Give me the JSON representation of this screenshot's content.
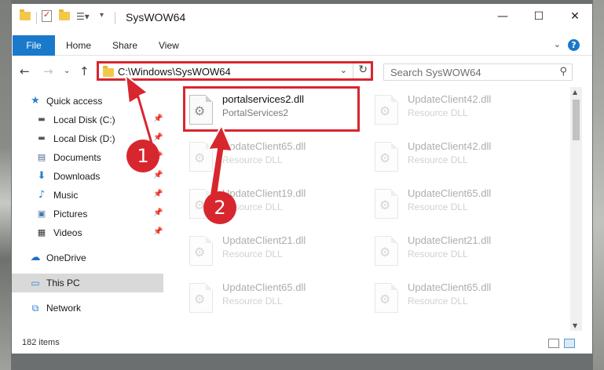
{
  "window": {
    "title": "SysWOW64",
    "controls": {
      "minimize": "—",
      "maximize": "☐",
      "close": "✕"
    }
  },
  "ribbon": {
    "tabs": [
      "File",
      "Home",
      "Share",
      "View"
    ],
    "help": "?"
  },
  "navbar": {
    "address": "C:\\Windows\\SysWOW64",
    "search_placeholder": "Search SysWOW64"
  },
  "sidebar": {
    "items": [
      {
        "label": "Quick access",
        "icon": "star-icon",
        "pinned": false
      },
      {
        "label": "Local Disk (C:)",
        "icon": "drive-icon",
        "pinned": true
      },
      {
        "label": "Local Disk (D:)",
        "icon": "drive-icon",
        "pinned": true
      },
      {
        "label": "Documents",
        "icon": "documents-icon",
        "pinned": true
      },
      {
        "label": "Downloads",
        "icon": "download-icon",
        "pinned": true
      },
      {
        "label": "Music",
        "icon": "music-icon",
        "pinned": true
      },
      {
        "label": "Pictures",
        "icon": "pictures-icon",
        "pinned": true
      },
      {
        "label": "Videos",
        "icon": "videos-icon",
        "pinned": true
      },
      {
        "label": "OneDrive",
        "icon": "cloud-icon",
        "pinned": false
      },
      {
        "label": "This PC",
        "icon": "computer-icon",
        "pinned": false,
        "selected": true
      },
      {
        "label": "Network",
        "icon": "network-icon",
        "pinned": false
      }
    ]
  },
  "files": [
    {
      "name": "portalservices2.dll",
      "type": "PortalServices2",
      "highlighted": true
    },
    {
      "name": "UpdateClient42.dll",
      "type": "Resource DLL"
    },
    {
      "name": "UpdateClient65.dll",
      "type": "Resource DLL"
    },
    {
      "name": "UpdateClient42.dll",
      "type": "Resource DLL"
    },
    {
      "name": "UpdateClient19.dll",
      "type": "Resource DLL"
    },
    {
      "name": "UpdateClient65.dll",
      "type": "Resource DLL"
    },
    {
      "name": "UpdateClient21.dll",
      "type": "Resource DLL"
    },
    {
      "name": "UpdateClient21.dll",
      "type": "Resource DLL"
    },
    {
      "name": "UpdateClient65.dll",
      "type": "Resource DLL"
    },
    {
      "name": "UpdateClient65.dll",
      "type": "Resource DLL"
    }
  ],
  "status": {
    "count": "182 items"
  },
  "annotations": {
    "step1": "1",
    "step2": "2",
    "color": "#d8262e"
  }
}
